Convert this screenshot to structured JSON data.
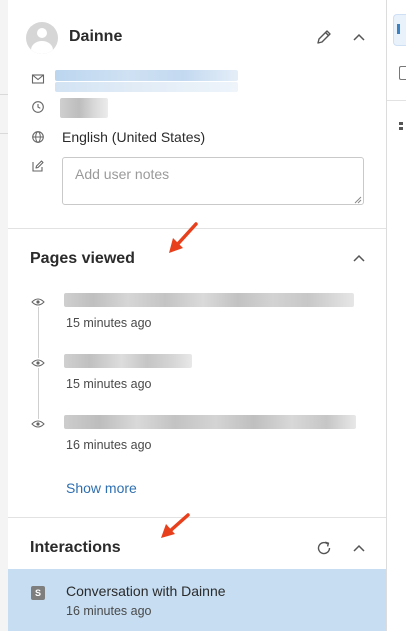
{
  "user": {
    "name": "Dainne",
    "language": "English (United States)",
    "notes_placeholder": "Add user notes",
    "notes_value": ""
  },
  "pages_viewed": {
    "title": "Pages viewed",
    "items": [
      {
        "time": "15 minutes ago"
      },
      {
        "time": "15 minutes ago"
      },
      {
        "time": "16 minutes ago"
      }
    ],
    "show_more": "Show more"
  },
  "interactions": {
    "title": "Interactions",
    "items": [
      {
        "badge": "S",
        "title": "Conversation with Dainne",
        "time": "16 minutes ago"
      }
    ]
  },
  "icons": {
    "avatar": "user-avatar-icon",
    "edit": "pencil-icon",
    "collapse": "chevron-up-icon",
    "email": "envelope-icon",
    "time": "clock-icon",
    "language": "globe-icon",
    "notes": "note-edit-icon",
    "viewed": "eye-icon",
    "refresh": "refresh-icon"
  },
  "colors": {
    "accent_link": "#2f6fb0",
    "selected_row": "#c6ddf2",
    "annotation_arrow": "#e8401c"
  }
}
